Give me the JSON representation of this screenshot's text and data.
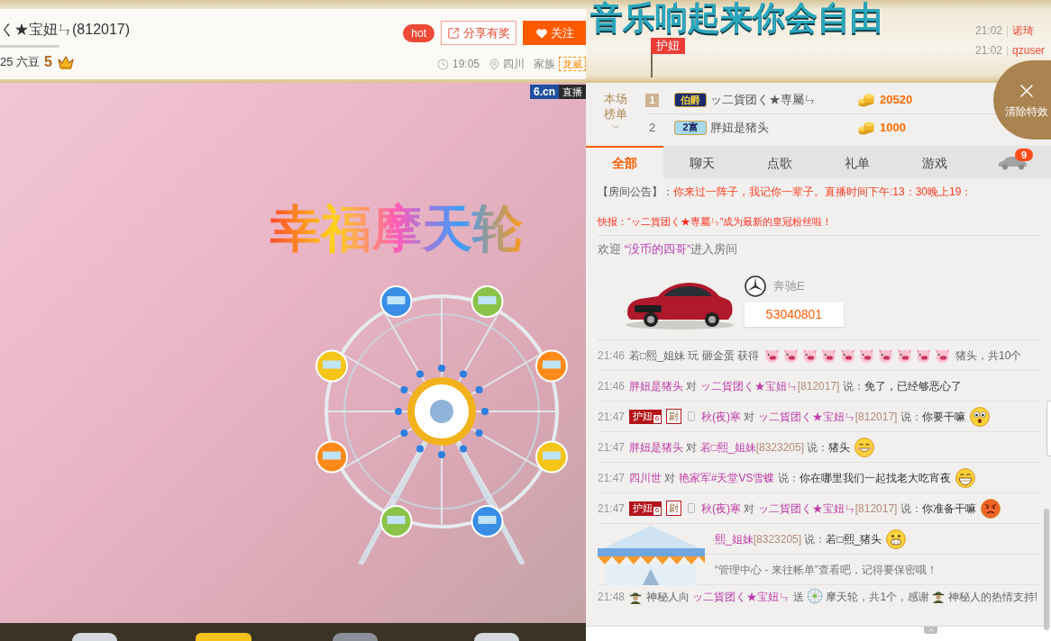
{
  "header": {
    "title": "音乐响起来你会自由",
    "host": "く★宝妞ㄣ(812017)",
    "beans": "25 六豆",
    "level": "5",
    "hot": "hot",
    "share": "分享有奖",
    "follow": "关注",
    "time": "19:05",
    "location": "四川",
    "family_label": "家族",
    "family": "龙威",
    "flag": "护妞",
    "arrivals": [
      {
        "time": "21:02",
        "name": "诺琦"
      },
      {
        "time": "21:02",
        "name": "qzuser"
      }
    ]
  },
  "video": {
    "logo": "6.cn",
    "live": "直播",
    "effect_title": "幸福摩天轮"
  },
  "ranking": {
    "label": "本场榜单",
    "rows": [
      {
        "rank": "1",
        "highlighted": true,
        "title": {
          "kind": "noble",
          "text": "伯爵"
        },
        "name": "ッ二貨团く★専屬ㄣ",
        "amount": "20520"
      },
      {
        "rank": "2",
        "highlighted": false,
        "title": {
          "kind": "rich",
          "text": "2富"
        },
        "name": "胖妞是猪头",
        "amount": "1000"
      }
    ]
  },
  "clear_effects": "清除特效",
  "tabs": [
    {
      "kind": "text",
      "label": "全部",
      "selected": true
    },
    {
      "kind": "text",
      "label": "聊天",
      "selected": false
    },
    {
      "kind": "text",
      "label": "点歌",
      "selected": false
    },
    {
      "kind": "text",
      "label": "礼单",
      "selected": false
    },
    {
      "kind": "text",
      "label": "游戏",
      "selected": false
    },
    {
      "kind": "car",
      "badge": "9",
      "selected": false
    }
  ],
  "chat": [
    {
      "kind": "notice",
      "label": "【房间公告】：",
      "text": "你来过一阵子，我记你一辈子。直播时间下午:13：30晚上19："
    },
    {
      "kind": "flash",
      "text": "快报：“ッ二貨团く★専屬ㄣ”成为最新的皇冠粉丝啦！"
    },
    {
      "kind": "welcome",
      "prefix": "欢迎 ",
      "name": "“没币的四哥”",
      "suffix": "进入房间"
    },
    {
      "kind": "car",
      "brand": "奔驰E",
      "number": "53040801"
    },
    {
      "kind": "prize",
      "time": "21:46",
      "text": "若□熙_姐妹 玩 砸金蛋 获得",
      "prizes": [
        {
          "kind": "pig"
        },
        {
          "kind": "pig"
        },
        {
          "kind": "pig"
        },
        {
          "kind": "pig"
        },
        {
          "kind": "pig"
        },
        {
          "kind": "pig"
        },
        {
          "kind": "pig"
        },
        {
          "kind": "pig"
        },
        {
          "kind": "pig"
        },
        {
          "kind": "pig"
        }
      ],
      "result": "猪头，共10个"
    },
    {
      "kind": "message",
      "time": "21:46",
      "phone": false,
      "from": "胖妞是猪头",
      "to_word": "对",
      "to": "ッ二貨团く★宝妞ㄣ",
      "to_id": "[812017]",
      "said": "说：",
      "text": "免了，已经够恶心了"
    },
    {
      "kind": "message",
      "time": "21:47",
      "guard": "护妞",
      "guard_level": "6",
      "rank_badge": "尉",
      "phone": true,
      "from": "秋(夜)寒",
      "to_word": "对",
      "to": "ッ二貨团く★宝妞ㄣ",
      "to_id": "[812017]",
      "said": "说：",
      "text": "你要干嘛",
      "emoji": {
        "kind": "surprised"
      }
    },
    {
      "kind": "message",
      "time": "21:47",
      "phone": false,
      "from": "胖妞是猪头",
      "to_word": "对",
      "to": "若□熙_姐妹",
      "to_id": "[8323205]",
      "said": "说：",
      "text": "猪头",
      "emoji": {
        "kind": "grin"
      }
    },
    {
      "kind": "message",
      "time": "21:47",
      "phone": false,
      "from": "四川世",
      "to_word": "对",
      "to": "艳家军#天堂VS雪蝶",
      "said": "说：",
      "text": "你在哪里我们一起找老大吃宵夜",
      "emoji": {
        "kind": "laugh"
      }
    },
    {
      "kind": "message",
      "time": "21:47",
      "guard": "护妞",
      "guard_level": "6",
      "rank_badge": "尉",
      "phone": true,
      "from": "秋(夜)寒",
      "to_word": "对",
      "to": "ッ二貨团く★宝妞ㄣ",
      "to_id": "[812017]",
      "said": "说：",
      "text": "你准备干嘛",
      "emoji": {
        "kind": "angry"
      }
    },
    {
      "kind": "message",
      "phone": false,
      "to": "熙_姐妹",
      "to_id": "[8323205]",
      "said": "说：",
      "text": "若□熙_猪头",
      "emoji": {
        "kind": "cheer"
      }
    },
    {
      "kind": "tip",
      "text": "“管理中心 - 来往帐单”查看吧，记得要保密哦！"
    },
    {
      "kind": "gift",
      "time": "21:48",
      "sender": "神秘人向",
      "receiver": "ッ二貨团く★宝妞ㄣ",
      "verb": "送",
      "gift": "摩天轮，共1个，感谢",
      "thanks": "神秘人的热情支持!"
    }
  ]
}
